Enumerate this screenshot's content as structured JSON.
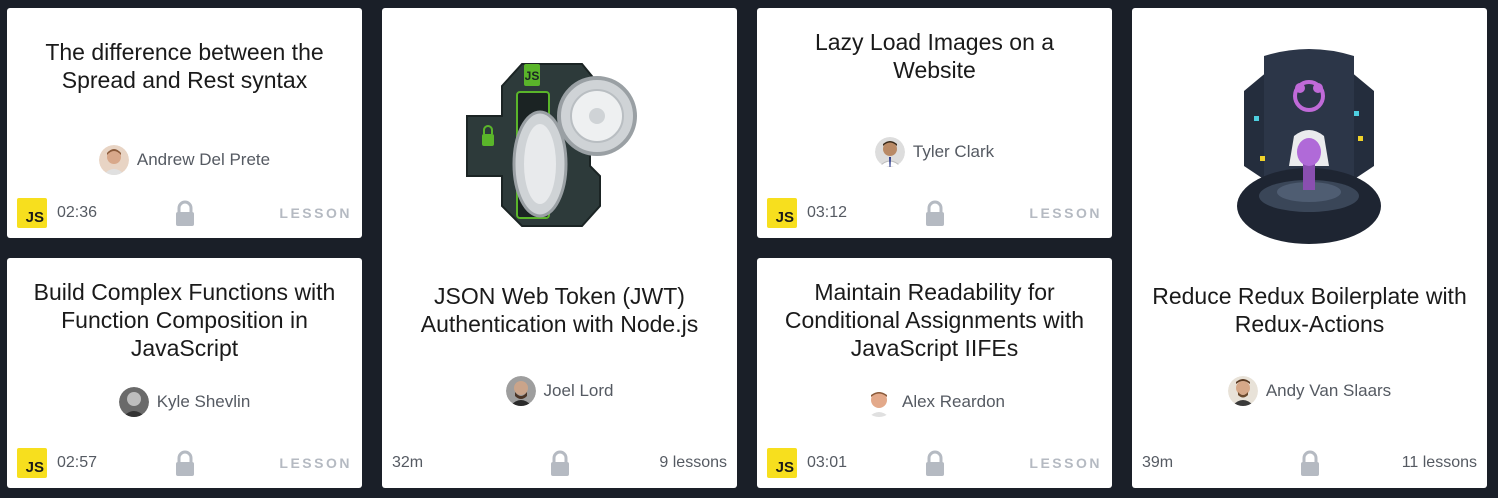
{
  "colors": {
    "background": "#1a1f28",
    "js_badge": "#f7df1e",
    "lock": "#b5bac2"
  },
  "cards": [
    {
      "title": "The difference between the Spread and Rest syntax",
      "author": "Andrew Del Prete",
      "badge": "JS",
      "duration": "02:36",
      "kind": "LESSON",
      "icon": "lock-icon"
    },
    {
      "title": "Build Complex Functions with Function Composition in JavaScript",
      "author": "Kyle Shevlin",
      "badge": "JS",
      "duration": "02:57",
      "kind": "LESSON",
      "icon": "lock-icon"
    },
    {
      "title": "JSON Web Token (JWT) Authentication with Node.js",
      "author": "Joel Lord",
      "duration": "32m",
      "lessons": "9 lessons",
      "icon": "lock-icon",
      "illustration": "node-jwt-vault-illustration"
    },
    {
      "title": "Lazy Load Images on a Website",
      "author": "Tyler Clark",
      "badge": "JS",
      "duration": "03:12",
      "kind": "LESSON",
      "icon": "lock-icon"
    },
    {
      "title": "Maintain Readability for Conditional Assignments with JavaScript IIFEs",
      "author": "Alex Reardon",
      "badge": "JS",
      "duration": "03:01",
      "kind": "LESSON",
      "icon": "lock-icon"
    },
    {
      "title": "Reduce Redux Boilerplate with Redux-Actions",
      "author": "Andy Van Slaars",
      "duration": "39m",
      "lessons": "11 lessons",
      "icon": "lock-icon",
      "illustration": "redux-illustration"
    }
  ]
}
